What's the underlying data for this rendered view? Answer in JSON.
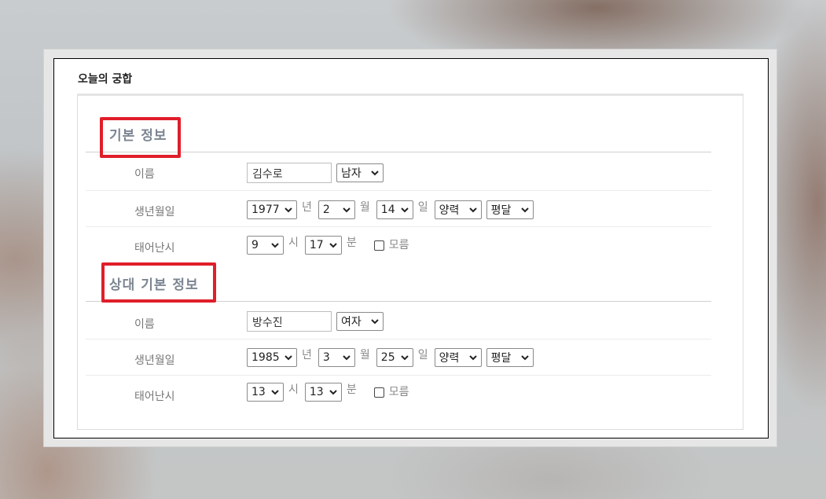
{
  "panel": {
    "title": "오늘의 궁합"
  },
  "colors": {
    "highlight": "#e01e2a",
    "section_title": "#7b8591"
  },
  "icons": {
    "dropdown": "chevron-down-icon"
  },
  "my_info": {
    "heading": "기본 정보",
    "name_label": "이름",
    "name_value": "김수로",
    "gender": "남자",
    "birth_label": "생년월일",
    "year": "1977",
    "year_unit": "년",
    "month": "2",
    "month_unit": "월",
    "day": "14",
    "day_unit": "일",
    "calendar": "양력",
    "leap": "평달",
    "time_label": "태어난시",
    "hour": "9",
    "hour_unit": "시",
    "minute": "17",
    "minute_unit": "분",
    "unknown_label": "모름"
  },
  "partner_info": {
    "heading": "상대 기본 정보",
    "name_label": "이름",
    "name_value": "방수진",
    "gender": "여자",
    "birth_label": "생년월일",
    "year": "1985",
    "year_unit": "년",
    "month": "3",
    "month_unit": "월",
    "day": "25",
    "day_unit": "일",
    "calendar": "양력",
    "leap": "평달",
    "time_label": "태어난시",
    "hour": "13",
    "hour_unit": "시",
    "minute": "13",
    "minute_unit": "분",
    "unknown_label": "모름"
  }
}
